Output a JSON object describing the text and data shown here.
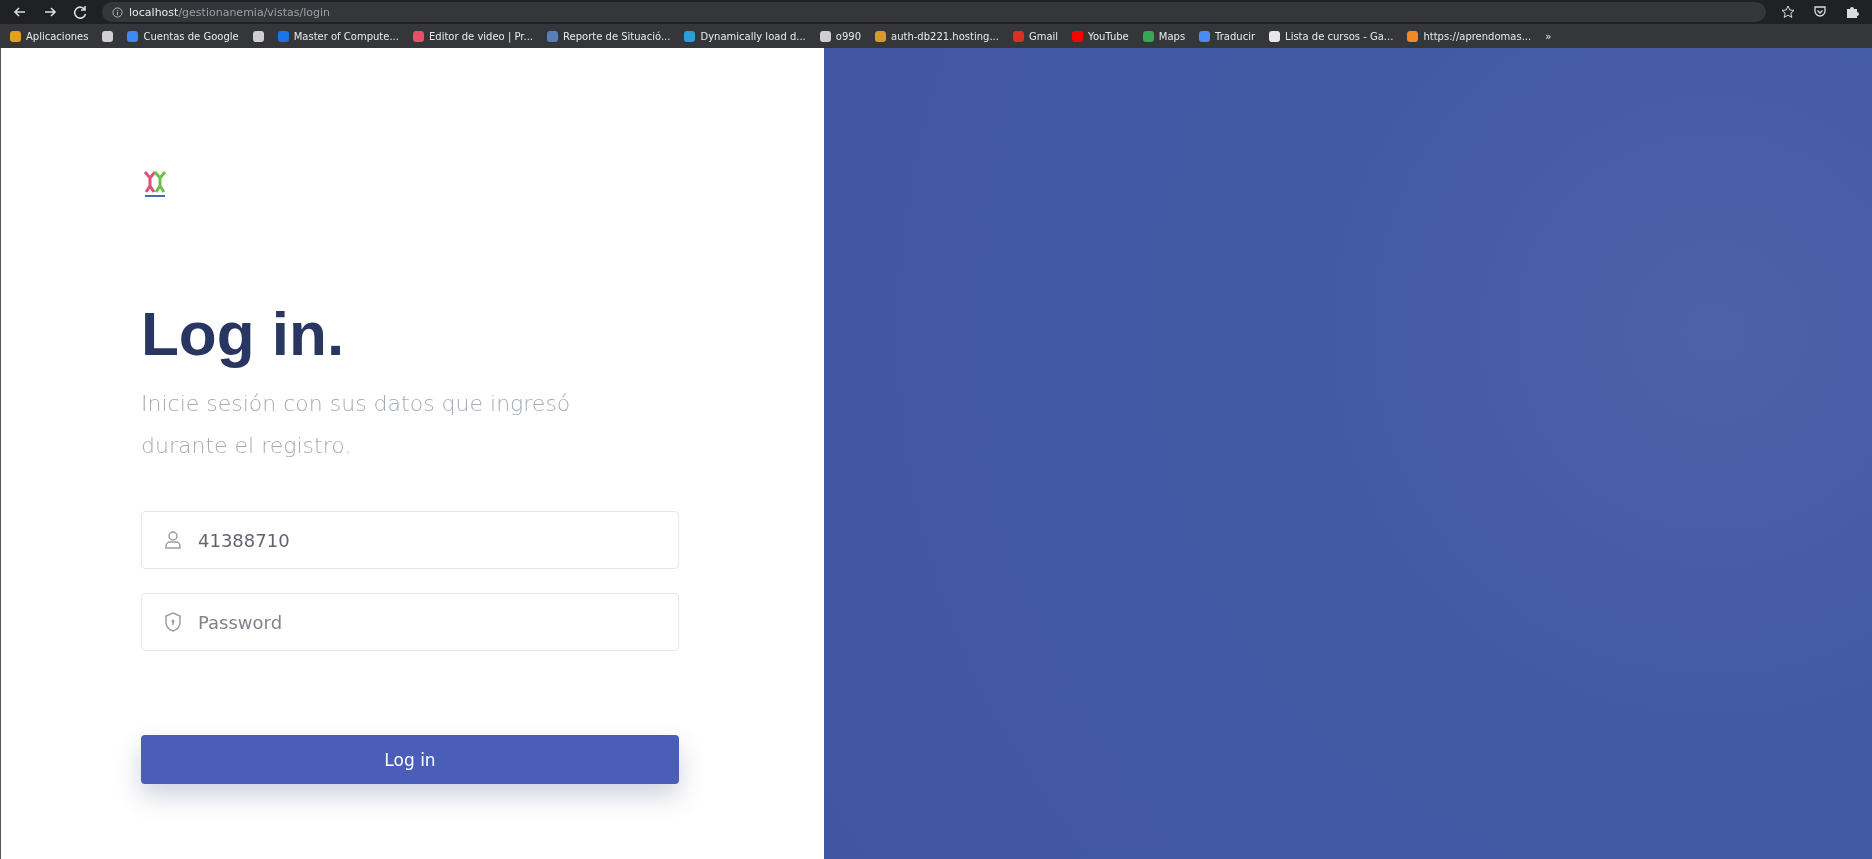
{
  "browser": {
    "address_host": "localhost",
    "address_path": "/gestionanemia/vistas/login",
    "bookmarks": [
      {
        "label": "Aplicaciones",
        "color": "#e0a020"
      },
      {
        "color": "#cfcfcf"
      },
      {
        "label": "Cuentas de Google",
        "color": "#4285f4"
      },
      {
        "color": "#cfcfcf"
      },
      {
        "label": "Master of Compute...",
        "color": "#1a73e8"
      },
      {
        "label": "Editor de video | Pr...",
        "color": "#e84d6a"
      },
      {
        "label": "Reporte de Situació...",
        "color": "#5a7fb8"
      },
      {
        "label": "Dynamically load d...",
        "color": "#2a9fd6"
      },
      {
        "label": "o990",
        "color": "#cfcfcf"
      },
      {
        "label": "auth-db221.hosting...",
        "color": "#d89a2a"
      },
      {
        "label": "Gmail",
        "color": "#d93025"
      },
      {
        "label": "YouTube",
        "color": "#ff0000"
      },
      {
        "label": "Maps",
        "color": "#34a853"
      },
      {
        "label": "Traducir",
        "color": "#4a8af4"
      },
      {
        "label": "Lista de cursos - Ga...",
        "color": "#e8e8e8"
      },
      {
        "label": "https://aprendomas...",
        "color": "#f08a24"
      }
    ],
    "overflow": "»"
  },
  "login": {
    "title": "Log in.",
    "subtitle": "Inicie sesión con sus datos que ingresó durante el registro.",
    "username_value": "41388710",
    "password_placeholder": "Password",
    "button": "Log in"
  }
}
